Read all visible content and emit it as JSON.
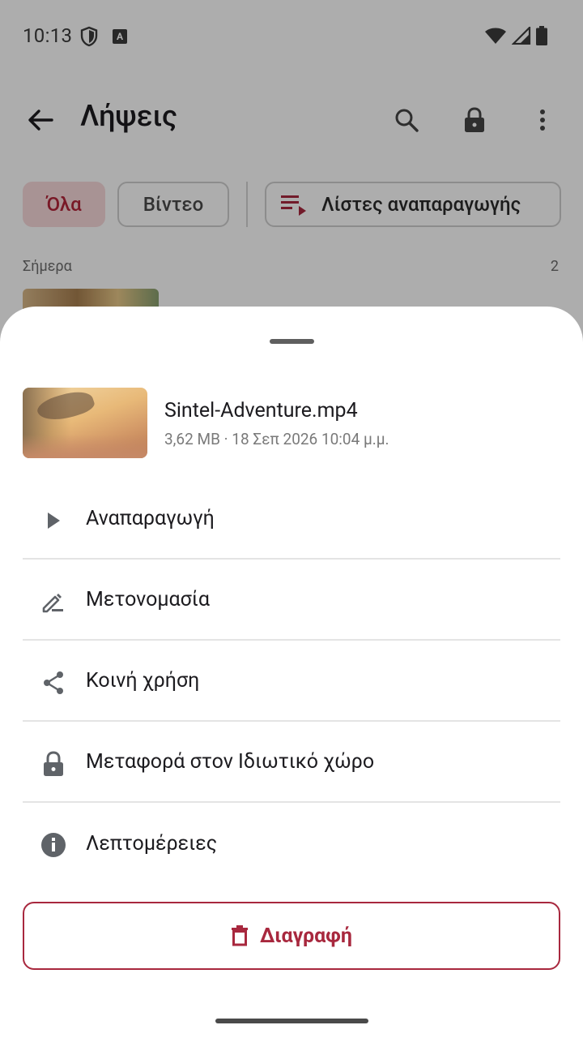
{
  "status_bar": {
    "time": "10:13",
    "notification_letter": "A"
  },
  "toolbar": {
    "title": "Λήψεις"
  },
  "chips": {
    "all": "Όλα",
    "video": "Βίντεο",
    "playlists": "Λίστες αναπαραγωγής"
  },
  "section": {
    "label": "Σήμερα",
    "count": "2"
  },
  "file": {
    "name": "Sintel-Adventure.mp4",
    "meta": "3,62 MB · 18 Σεπ 2026 10:04 μ.μ."
  },
  "menu": {
    "items": [
      {
        "label": "Αναπαραγωγή",
        "icon": "play-icon"
      },
      {
        "label": "Μετονομασία",
        "icon": "edit-icon"
      },
      {
        "label": "Κοινή χρήση",
        "icon": "share-icon"
      },
      {
        "label": "Μεταφορά στον Ιδιωτικό χώρο",
        "icon": "lock-icon"
      },
      {
        "label": "Λεπτομέρειες",
        "icon": "info-icon"
      }
    ]
  },
  "delete_button": {
    "label": "Διαγραφή"
  },
  "colors": {
    "accent": "#a8283e",
    "chip_selected_bg": "#f8d9db",
    "icon_gray": "#5f6368",
    "scrim": "rgba(0,0,0,0.32)"
  }
}
